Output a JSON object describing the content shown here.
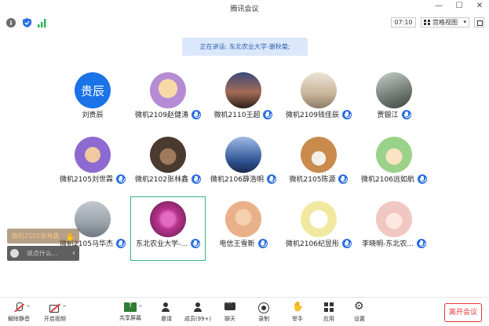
{
  "window": {
    "title": "腾讯会议",
    "controls": [
      "minimize-icon",
      "maximize-icon",
      "close-icon"
    ]
  },
  "infobar": {
    "timer": "07:10",
    "view_label": "宫格视图",
    "signal_color": "#2db55d",
    "shield_color": "#2a6fe0"
  },
  "speaking": {
    "text": "正在讲话: 东北农业大学-谢秋菊;"
  },
  "participants": [
    {
      "name": "刘贵辰",
      "avatar_text": "贵辰",
      "avatar_color": "#1a73e8"
    },
    {
      "name": "微机2109赵健涛",
      "avatar_color": "#b58bd4"
    },
    {
      "name": "微机2110王超",
      "avatar_color": "#5e4a3a"
    },
    {
      "name": "微机2109钱佳辰",
      "avatar_color": "#c8b49a"
    },
    {
      "name": "贾银江",
      "avatar_color": "#6f7a72"
    },
    {
      "name": "微机2105刘世霖",
      "avatar_color": "#8d6ad1"
    },
    {
      "name": "微机2102张林鑫",
      "avatar_color": "#4a3a2f"
    },
    {
      "name": "微机2106薛浩明",
      "avatar_color": "#2c4f8f"
    },
    {
      "name": "微机2105陈源",
      "avatar_color": "#c98a4d"
    },
    {
      "name": "微机2106远如航",
      "avatar_color": "#9bd28a"
    },
    {
      "name": "微机2105马华杰",
      "avatar_color": "#9aa3ac"
    },
    {
      "name": "东北农业大学-...",
      "avatar_color": "#b8338c"
    },
    {
      "name": "电信王雪新",
      "avatar_color": "#e9b18a"
    },
    {
      "name": "微机2106纪昱彤",
      "avatar_color": "#f2e9a0"
    },
    {
      "name": "李晓明-东北农...",
      "avatar_color": "#f1c7c2"
    }
  ],
  "chat": {
    "message": "微机2102张林鑫",
    "placeholder": "说点什么..."
  },
  "toolbar": {
    "mute": "解除静音",
    "video": "开启视频",
    "share": "共享屏幕",
    "invite": "邀请",
    "members": "成员(99+)",
    "chat": "聊天",
    "record": "录制",
    "raise": "举手",
    "apps": "应用",
    "settings": "设置",
    "leave": "离开会议"
  }
}
